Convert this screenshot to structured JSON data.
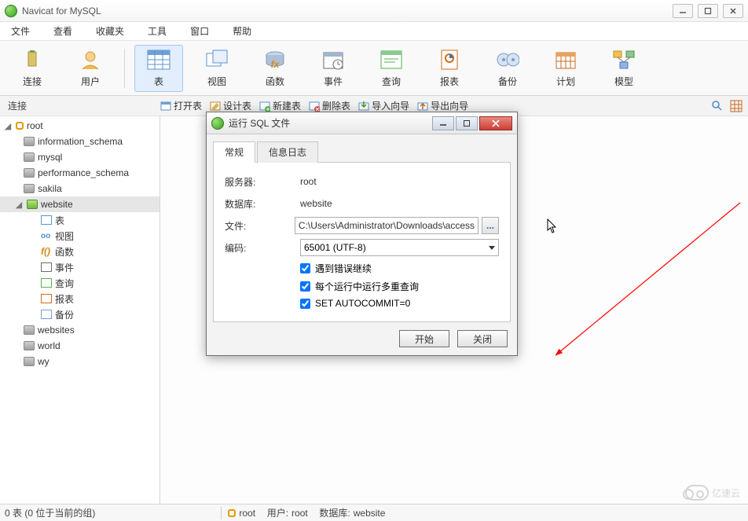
{
  "app": {
    "title": "Navicat for MySQL"
  },
  "menu": {
    "file": "文件",
    "view": "查看",
    "fav": "收藏夹",
    "tools": "工具",
    "window": "窗口",
    "help": "帮助"
  },
  "toolbar": {
    "connect": "连接",
    "user": "用户",
    "table": "表",
    "viewbtn": "视图",
    "func": "函数",
    "event": "事件",
    "query": "查询",
    "report": "报表",
    "backup": "备份",
    "schedule": "计划",
    "model": "模型"
  },
  "subbar": {
    "connLabel": "连接",
    "open": "打开表",
    "design": "设计表",
    "newt": "新建表",
    "delt": "删除表",
    "impw": "导入向导",
    "expw": "导出向导"
  },
  "tree": {
    "root": "root",
    "db1": "information_schema",
    "db2": "mysql",
    "db3": "performance_schema",
    "db4": "sakila",
    "db5": "website",
    "n_table": "表",
    "n_view": "视图",
    "n_func": "函数",
    "n_event": "事件",
    "n_query": "查询",
    "n_report": "报表",
    "n_backup": "备份",
    "db6": "websites",
    "db7": "world",
    "db8": "wy"
  },
  "dialog": {
    "title": "运行 SQL 文件",
    "tab_general": "常规",
    "tab_log": "信息日志",
    "lbl_server": "服务器:",
    "val_server": "root",
    "lbl_db": "数据库:",
    "val_db": "website",
    "lbl_file": "文件:",
    "val_file": "C:\\Users\\Administrator\\Downloads\\access",
    "browse": "...",
    "lbl_enc": "编码:",
    "val_enc": "65001 (UTF-8)",
    "chk1": "遇到错误继续",
    "chk2": "每个运行中运行多重查询",
    "chk3": "SET AUTOCOMMIT=0",
    "btn_start": "开始",
    "btn_close": "关闭"
  },
  "status": {
    "left": "0 表 (0 位于当前的组)",
    "conn": "root",
    "userlbl": "用户:",
    "user": "root",
    "dblbl": "数据库:",
    "db": "website"
  },
  "watermark": "亿速云"
}
